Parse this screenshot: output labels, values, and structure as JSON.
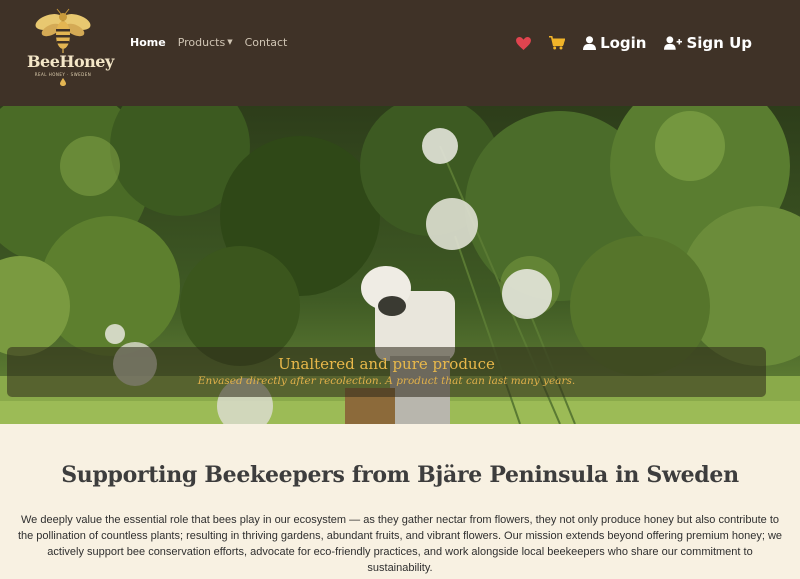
{
  "brand": {
    "name": "BeeHoney",
    "tagline": "REAL HONEY · SWEDEN"
  },
  "nav": {
    "links": [
      {
        "label": "Home",
        "active": true
      },
      {
        "label": "Products",
        "dropdown": true
      },
      {
        "label": "Contact"
      }
    ],
    "wishlist_icon": "heart-icon",
    "cart_icon": "cart-icon",
    "login_label": "Login",
    "signup_label": "Sign Up"
  },
  "hero": {
    "caption_title": "Unaltered and pure produce",
    "caption_text": "Envased directly after recolection. A product that can last many years."
  },
  "about": {
    "title": "Supporting Beekeepers from Bjäre Peninsula in Sweden",
    "text": "We deeply value the essential role that bees play in our ecosystem — as they gather nectar from flowers, they not only produce honey but also contribute to the pollination of countless plants; resulting in thriving gardens, abundant fruits, and vibrant flowers. Our mission extends beyond offering premium honey; we actively support bee conservation efforts, advocate for eco-friendly practices, and work alongside local beekeepers who share our commitment to sustainability."
  },
  "colors": {
    "navbar_bg": "#3f3227",
    "page_bg": "#f8f1e2",
    "accent_gold": "#e8b84a",
    "heart": "#e0444f",
    "cart": "#f0b429"
  }
}
